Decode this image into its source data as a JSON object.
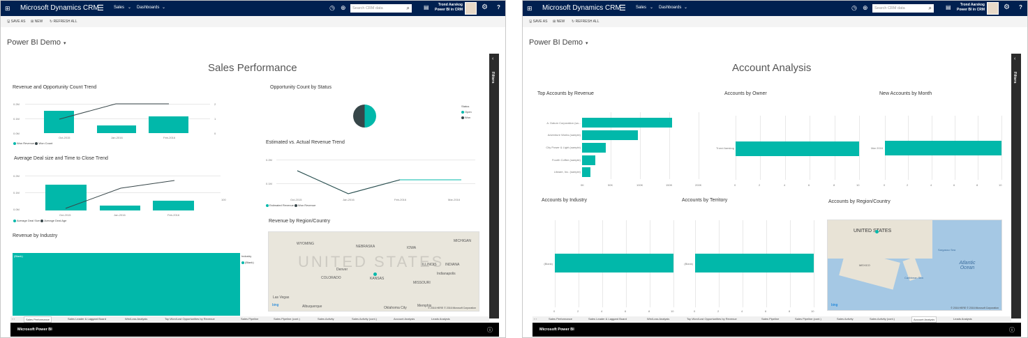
{
  "crm": {
    "brand": "Microsoft Dynamics CRM",
    "nav_area": "Sales",
    "nav_page": "Dashboards",
    "search_placeholder": "Search CRM data",
    "user_line1": "Trond Aarskog",
    "user_line2": "Power BI in CRM",
    "help": "?"
  },
  "commands": {
    "save_as": "SAVE AS",
    "new": "NEW",
    "refresh_all": "REFRESH ALL"
  },
  "dashboard_title": "Power BI Demo",
  "filters_label": "Filters",
  "footer_label": "Microsoft Power BI",
  "tabs": [
    "Sales Performance",
    "Sales Leader & Laggard Board",
    "Win/Loss Analysis",
    "Top Won/Lost Opportunities by Revenue",
    "Sales Pipeline",
    "Sales Pipeline (cont.)",
    "Sales Activity",
    "Sales Activity (cont.)",
    "Account Analysis",
    "Leads Analysis"
  ],
  "colors": {
    "teal": "#01b8aa",
    "dark": "#374649",
    "crm_nav": "#002050"
  },
  "left": {
    "report_title": "Sales Performance",
    "rev_opp": {
      "title": "Revenue and Opportunity Count Trend",
      "yticks": [
        "0.2M",
        "0.1M",
        "0.0M"
      ],
      "y2ticks": [
        "2",
        "1",
        "0"
      ],
      "categories": [
        "Oct-2015",
        "Jan-2016",
        "Feb-2016"
      ],
      "legend": [
        "Won Revenue",
        "Won Count"
      ]
    },
    "opp_status": {
      "title": "Opportunity Count by Status",
      "legend_title": "Status",
      "legend": [
        "Open",
        "Won"
      ]
    },
    "avg_deal": {
      "title": "Average Deal size and Time to Close Trend",
      "yticks": [
        "0.2M",
        "0.1M",
        "0.0M"
      ],
      "y2tick": "100",
      "categories": [
        "Oct-2015",
        "Jan-2016",
        "Feb-2016"
      ],
      "legend": [
        "Average Deal Size",
        "Average Deal Age"
      ]
    },
    "est_act": {
      "title": "Estimated vs. Actual Revenue Trend",
      "yticks": [
        "0.2M",
        "0.1M"
      ],
      "categories": [
        "Oct-2015",
        "Jan-2016",
        "Feb-2016",
        "Mar-2016"
      ],
      "legend": [
        "Estimated Revenue",
        "Won Revenue"
      ]
    },
    "industry": {
      "title": "Revenue by Industry",
      "block_label": "(Blank)",
      "legend_title": "Industry",
      "legend": [
        "(Blank)"
      ]
    },
    "region": {
      "title": "Revenue by Region/Country",
      "labels": [
        "WYOMING",
        "NEBRASKA",
        "IOWA",
        "MICHIGAN",
        "ILLINOIS",
        "INDIANA",
        "COLORADO",
        "KANSAS",
        "MISSOURI",
        "Denver",
        "Indianapolis",
        "Las Vegas",
        "Albuquerque",
        "Oklahoma City",
        "Memphis"
      ],
      "watermark": "UNITED STATES",
      "attribution": "© 2016 HERE  © 2016 Microsoft Corporation",
      "bing": "bing"
    }
  },
  "right": {
    "report_title": "Account Analysis",
    "top_accounts": {
      "title": "Top Accounts by Revenue",
      "categories": [
        "A. Datum Corporation (sa...",
        "Adventure Works (sample)",
        "City Power & Light (sample)",
        "Fourth Coffee (sample)",
        "Litware, Inc. (sample)"
      ],
      "xticks": [
        "0K",
        "50K",
        "100K",
        "150K",
        "200K"
      ]
    },
    "by_owner": {
      "title": "Accounts by Owner",
      "category": "Trond Aarskog",
      "xticks": [
        "0",
        "2",
        "4",
        "6",
        "8",
        "10"
      ]
    },
    "new_by_month": {
      "title": "New Accounts by Month",
      "category": "Mar 2016",
      "xticks": [
        "0",
        "2",
        "4",
        "6",
        "8",
        "10"
      ]
    },
    "by_industry": {
      "title": "Accounts by Industry",
      "category": "(Blank)",
      "xticks": [
        "0",
        "2",
        "4",
        "6",
        "8",
        "10"
      ]
    },
    "by_territory": {
      "title": "Accounts by Territory",
      "category": "(Blank)",
      "xticks": [
        "0",
        "2",
        "4",
        "6",
        "8",
        "10"
      ]
    },
    "by_region": {
      "title": "Accounts by Region/Country",
      "labels": [
        "UNITED STATES",
        "MEXICO",
        "Atlantic Ocean",
        "Sargasso Sea",
        "Caribbean Sea"
      ],
      "attribution": "© 2016 HERE  © 2016 Microsoft Corporation",
      "bing": "bing"
    }
  },
  "chart_data": [
    {
      "type": "bar",
      "title": "Revenue and Opportunity Count Trend",
      "categories": [
        "Oct-2015",
        "Jan-2016",
        "Feb-2016"
      ],
      "series": [
        {
          "name": "Won Revenue",
          "values": [
            0.16,
            0.05,
            0.12
          ]
        },
        {
          "name": "Won Count",
          "values": [
            1,
            2,
            2
          ]
        }
      ],
      "ylim": [
        0,
        0.2
      ]
    },
    {
      "type": "pie",
      "title": "Opportunity Count by Status",
      "categories": [
        "Open",
        "Won"
      ],
      "values": [
        1,
        1
      ]
    },
    {
      "type": "bar",
      "title": "Average Deal size and Time to Close Trend",
      "categories": [
        "Oct-2015",
        "Jan-2016",
        "Feb-2016"
      ],
      "series": [
        {
          "name": "Average Deal Size",
          "values": [
            0.16,
            0.03,
            0.06
          ]
        },
        {
          "name": "Average Deal Age",
          "values": [
            20,
            75,
            95
          ]
        }
      ],
      "ylim": [
        0,
        0.2
      ]
    },
    {
      "type": "line",
      "title": "Estimated vs. Actual Revenue Trend",
      "categories": [
        "Oct-2015",
        "Jan-2016",
        "Feb-2016",
        "Mar-2016"
      ],
      "series": [
        {
          "name": "Estimated Revenue",
          "values": [
            0.15,
            0.03,
            0.12,
            0.12
          ]
        },
        {
          "name": "Won Revenue",
          "values": [
            0.15,
            0.03,
            0.12,
            null
          ]
        }
      ]
    },
    {
      "type": "bar",
      "title": "Top Accounts by Revenue",
      "categories": [
        "A. Datum Corporation (sa...",
        "Adventure Works (sample)",
        "City Power & Light (sample)",
        "Fourth Coffee (sample)",
        "Litware, Inc. (sample)"
      ],
      "values": [
        155000,
        95000,
        40000,
        22000,
        15000
      ],
      "xlim": [
        0,
        200000
      ]
    },
    {
      "type": "bar",
      "title": "Accounts by Owner",
      "categories": [
        "Trond Aarskog"
      ],
      "values": [
        10
      ],
      "xlim": [
        0,
        10
      ]
    },
    {
      "type": "bar",
      "title": "New Accounts by Month",
      "categories": [
        "Mar 2016"
      ],
      "values": [
        10
      ],
      "xlim": [
        0,
        10
      ]
    },
    {
      "type": "bar",
      "title": "Accounts by Industry",
      "categories": [
        "(Blank)"
      ],
      "values": [
        10
      ],
      "xlim": [
        0,
        10
      ]
    },
    {
      "type": "bar",
      "title": "Accounts by Territory",
      "categories": [
        "(Blank)"
      ],
      "values": [
        10
      ],
      "xlim": [
        0,
        10
      ]
    }
  ]
}
